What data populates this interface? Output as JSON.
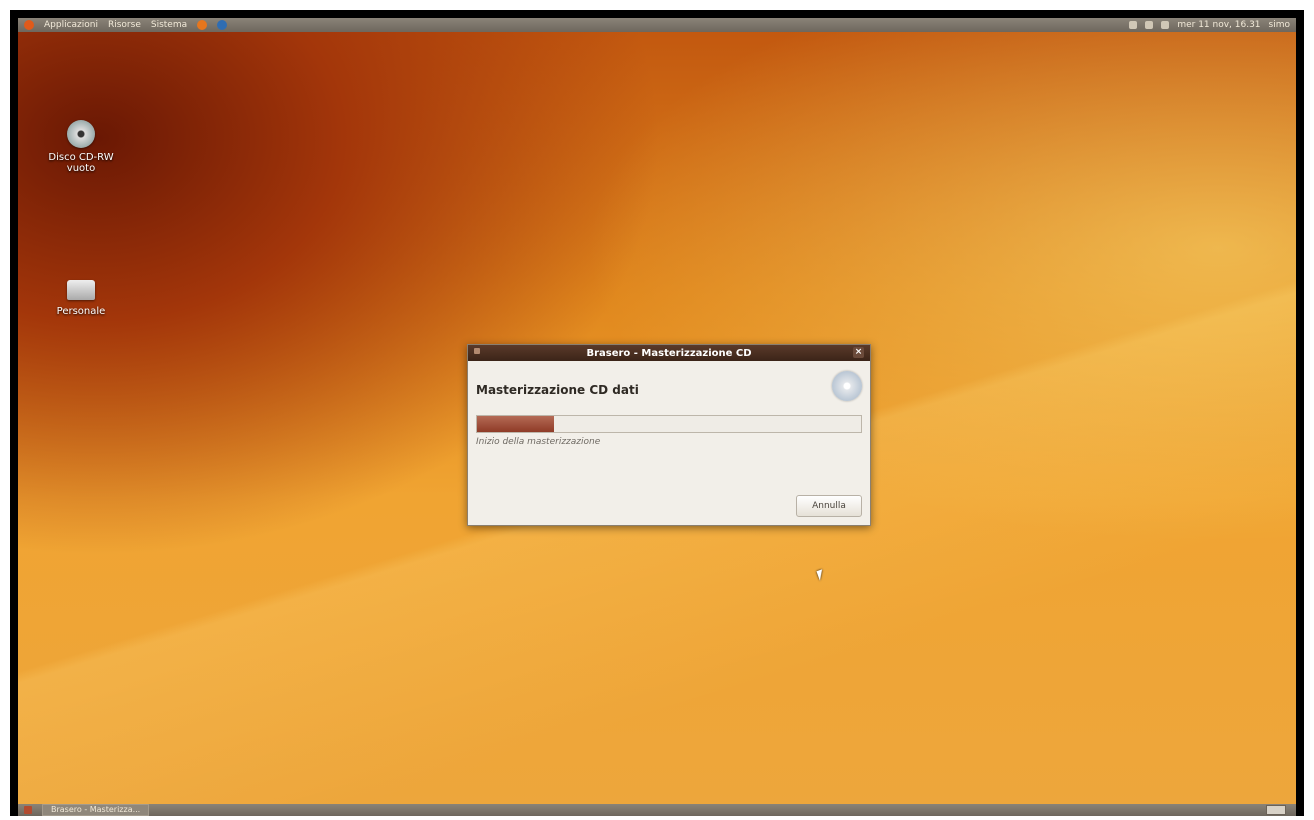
{
  "top_panel": {
    "menu_items": [
      "Applicazioni",
      "Risorse",
      "Sistema"
    ],
    "clock": "mer 11 nov, 16.31",
    "user_label": "simo"
  },
  "desktop": {
    "icons": [
      {
        "label": "Disco CD-RW vuoto"
      },
      {
        "label": "Personale"
      }
    ]
  },
  "dialog": {
    "title": "Brasero - Masterizzazione CD",
    "heading": "Masterizzazione CD dati",
    "status": "Inizio della masterizzazione",
    "progress_percent": 20,
    "cancel_label": "Annulla"
  },
  "taskbar": {
    "active_task": "Brasero - Masterizza..."
  },
  "colors": {
    "accent": "#8f3b27",
    "titlebar": "#3b2418",
    "panel": "#7b7468"
  }
}
